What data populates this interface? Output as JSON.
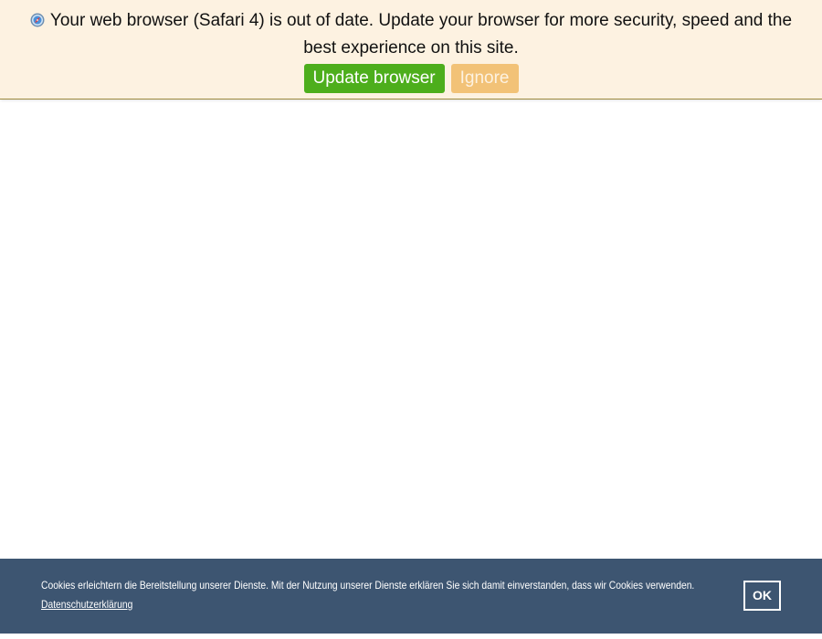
{
  "update_bar": {
    "message": "Your web browser (Safari 4) is out of date. Update your browser for more security, speed and the best experience on this site.",
    "update_button_label": "Update browser",
    "ignore_button_label": "Ignore",
    "icon": "safari-browser-icon",
    "colors": {
      "background": "#fdf2e1",
      "update_button": "#4dae1c",
      "ignore_button": "#f2c277"
    }
  },
  "cookie_bar": {
    "message": "Cookies erleichtern die Bereitstellung unserer Dienste. Mit der Nutzung unserer Dienste erklären Sie sich damit einverstanden, dass wir Cookies verwenden.",
    "privacy_link_label": "Datenschutzerklärung",
    "ok_button_label": "OK",
    "colors": {
      "background": "#3d5571",
      "text": "#ffffff"
    }
  }
}
